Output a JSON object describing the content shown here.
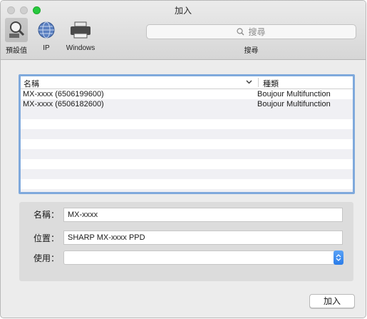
{
  "window": {
    "title": "加入"
  },
  "toolbar": {
    "default_label": "預設值",
    "ip_label": "IP",
    "windows_label": "Windows"
  },
  "search": {
    "placeholder": "搜尋",
    "caption": "搜尋"
  },
  "list": {
    "columns": {
      "name": "名稱",
      "kind": "種類"
    },
    "rows": [
      {
        "name": "MX-xxxx (6506199600)",
        "kind": "Boujour Multifunction"
      },
      {
        "name": "MX-xxxx (6506182600)",
        "kind": "Boujour Multifunction"
      }
    ]
  },
  "form": {
    "name_label": "名稱：",
    "name_value": "MX-xxxx",
    "location_label": "位置：",
    "location_value": "SHARP MX-xxxx PPD",
    "use_label": "使用：",
    "use_value": ""
  },
  "footer": {
    "add_label": "加入"
  },
  "colors": {
    "accent": "#7fa9dc",
    "select_button": "#2a7ce8",
    "zoom": "#27c93f"
  }
}
